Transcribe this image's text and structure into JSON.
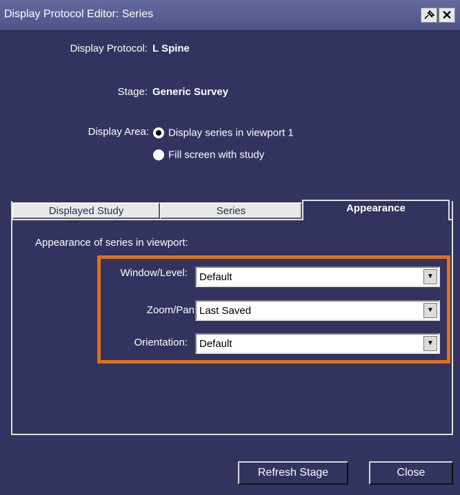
{
  "window": {
    "title": "Display Protocol Editor: Series",
    "pin_icon": "pin-icon",
    "close_symbol": "✕"
  },
  "display_protocol": {
    "label": "Display Protocol:",
    "value": "L Spine"
  },
  "stage": {
    "label": "Stage:",
    "value": "Generic Survey"
  },
  "display_area": {
    "label": "Display Area:",
    "options": [
      {
        "label": "Display series in viewport 1",
        "selected": true
      },
      {
        "label": "Fill screen with study",
        "selected": false
      }
    ]
  },
  "tabs": [
    {
      "label": "Displayed Study",
      "active": false
    },
    {
      "label": "Series",
      "active": false
    },
    {
      "label": "Appearance",
      "active": true
    }
  ],
  "appearance": {
    "section_label": "Appearance of series in viewport:",
    "fields": [
      {
        "label": "Window/Level:",
        "value": "Default"
      },
      {
        "label": "Zoom/Pan",
        "value": "Last Saved"
      },
      {
        "label": "Orientation:",
        "value": "Default"
      }
    ],
    "highlight_color": "#e0701a"
  },
  "buttons": {
    "refresh": "Refresh Stage",
    "close": "Close"
  }
}
